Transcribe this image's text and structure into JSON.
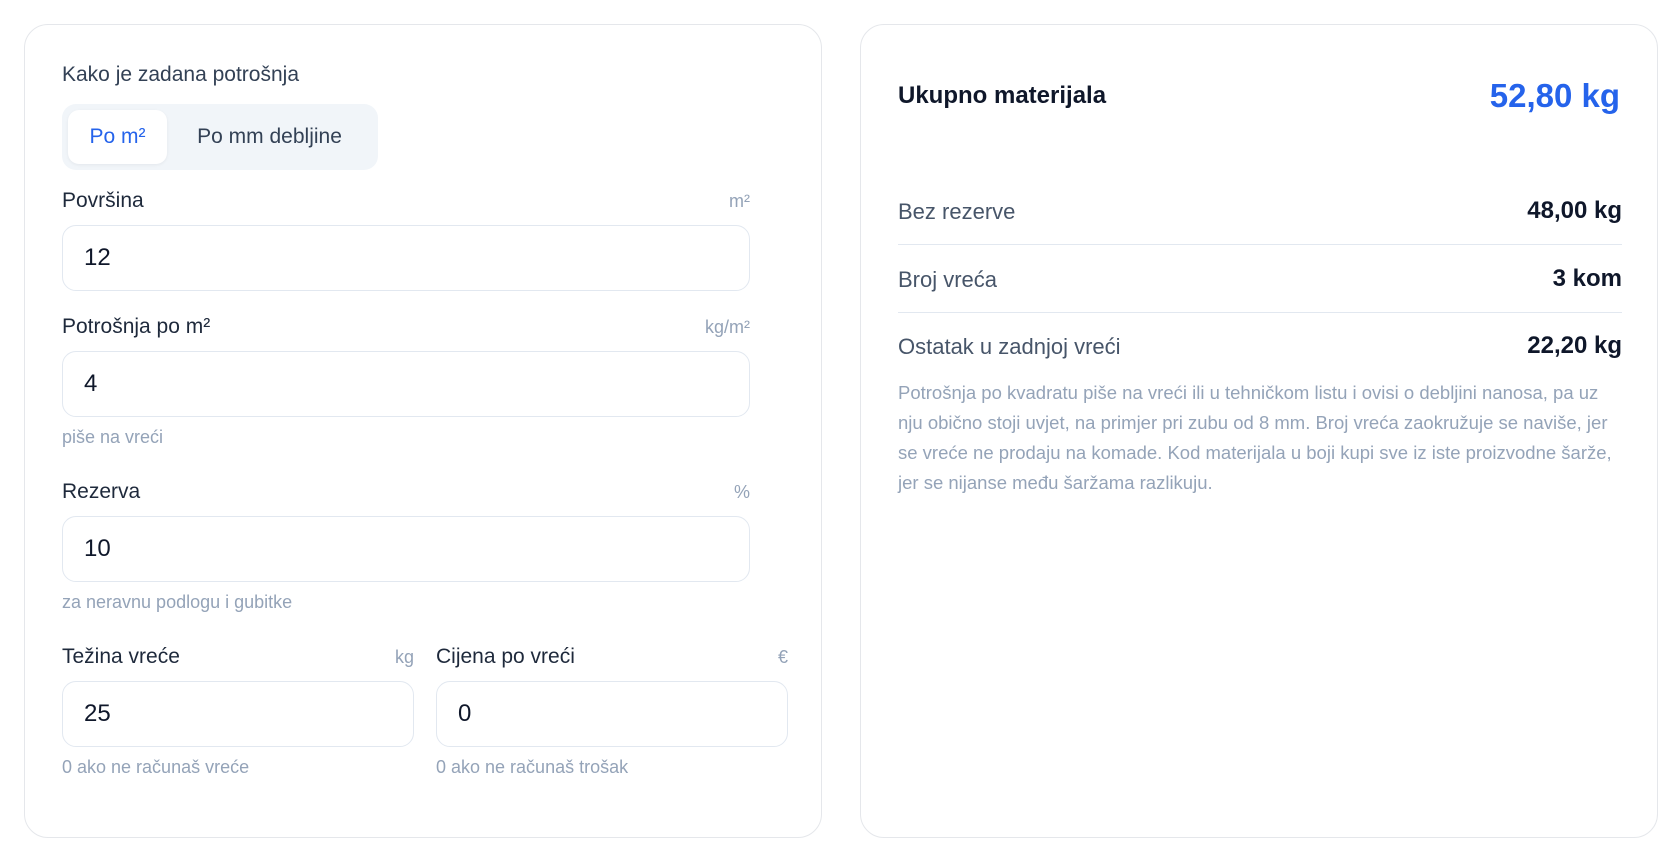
{
  "left": {
    "consumption_mode": {
      "title": "Kako je zadana potrošnja",
      "options": [
        "Po m²",
        "Po mm debljine"
      ],
      "selected": "Po m²"
    },
    "fields": {
      "area": {
        "label": "Površina",
        "unit": "m²",
        "value": "12"
      },
      "consumption": {
        "label": "Potrošnja po m²",
        "unit": "kg/m²",
        "value": "4",
        "hint": "piše na vreći"
      },
      "reserve": {
        "label": "Rezerva",
        "unit": "%",
        "value": "10",
        "hint": "za neravnu podlogu i gubitke"
      },
      "bag_weight": {
        "label": "Težina vreće",
        "unit": "kg",
        "value": "25",
        "hint": "0 ako ne računaš vreće"
      },
      "bag_price": {
        "label": "Cijena po vreći",
        "unit": "€",
        "value": "0",
        "hint": "0 ako ne računaš trošak"
      }
    }
  },
  "right": {
    "total": {
      "label": "Ukupno materijala",
      "value": "52,80 kg"
    },
    "rows": [
      {
        "label": "Bez rezerve",
        "value": "48,00 kg"
      },
      {
        "label": "Broj vreća",
        "value": "3 kom"
      },
      {
        "label": "Ostatak u zadnjoj vreći",
        "value": "22,20 kg"
      }
    ],
    "note": "Potrošnja po kvadratu piše na vreći ili u tehničkom listu i ovisi o debljini nanosa, pa uz nju obično stoji uvjet, na primjer pri zubu od 8 mm. Broj vreća zaokružuje se naviše, jer se vreće ne prodaju na komade. Kod materijala u boji kupi sve iz iste proizvodne šarže, jer se nijanse među šaržama razlikuju."
  },
  "colors": {
    "accent": "#2563eb",
    "border": "#e2e8f0",
    "muted": "#94a3b8",
    "text": "#0f172a"
  }
}
